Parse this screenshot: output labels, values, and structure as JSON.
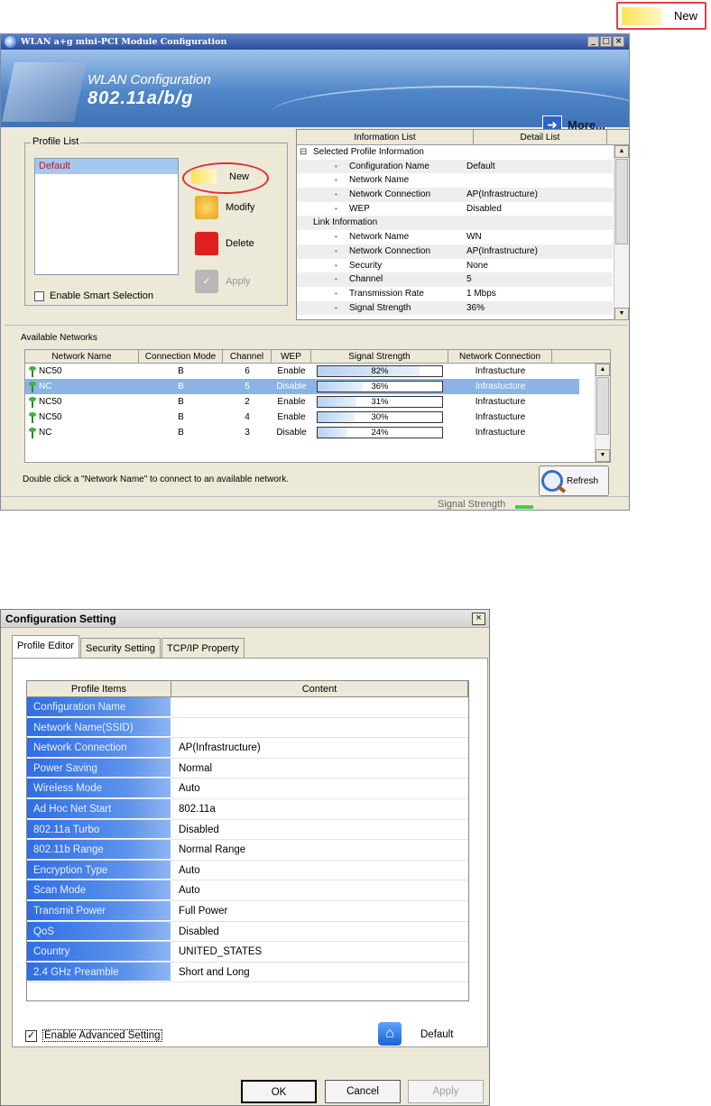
{
  "callout": {
    "label": "New"
  },
  "wlan_window": {
    "title": "WLAN a+g mini-PCI Module Configuration",
    "banner_line1": "WLAN Configuration",
    "banner_line2": "802.11a/b/g",
    "more_label": "More...",
    "profile_list": {
      "legend": "Profile List",
      "items": [
        "Default"
      ],
      "buttons": {
        "new": "New",
        "modify": "Modify",
        "delete": "Delete",
        "apply": "Apply"
      },
      "smart_selection_label": "Enable Smart Selection",
      "smart_selection_checked": false
    },
    "info_panel": {
      "headers": [
        "Information List",
        "Detail List"
      ],
      "rows": [
        {
          "type": "section",
          "label": "Selected Profile Information"
        },
        {
          "type": "item",
          "label": "Configuration Name",
          "value": "Default"
        },
        {
          "type": "item",
          "label": "Network Name",
          "value": ""
        },
        {
          "type": "item",
          "label": "Network Connection",
          "value": "AP(Infrastructure)"
        },
        {
          "type": "item",
          "label": "WEP",
          "value": "Disabled"
        },
        {
          "type": "section",
          "label": "Link Information"
        },
        {
          "type": "item",
          "label": "Network Name",
          "value": "WN"
        },
        {
          "type": "item",
          "label": "Network Connection",
          "value": "AP(Infrastructure)"
        },
        {
          "type": "item",
          "label": "Security",
          "value": "None"
        },
        {
          "type": "item",
          "label": "Channel",
          "value": "5"
        },
        {
          "type": "item",
          "label": "Transmission Rate",
          "value": "1 Mbps"
        },
        {
          "type": "item",
          "label": "Signal Strength",
          "value": "36%"
        }
      ]
    },
    "networks": {
      "title": "Available Networks",
      "headers": [
        "Network Name",
        "Connection Mode",
        "Channel",
        "WEP",
        "Signal Strength",
        "Network Connection"
      ],
      "rows": [
        {
          "name": "NC50",
          "mode": "B",
          "channel": "6",
          "wep": "Enable",
          "signal": "82%",
          "signal_fraction": 0.82,
          "connection": "Infrastucture",
          "selected": false
        },
        {
          "name": "NC",
          "mode": "B",
          "channel": "5",
          "wep": "Disable",
          "signal": "36%",
          "signal_fraction": 0.36,
          "connection": "Infrastucture",
          "selected": true
        },
        {
          "name": "NC50",
          "mode": "B",
          "channel": "2",
          "wep": "Enable",
          "signal": "31%",
          "signal_fraction": 0.31,
          "connection": "Infrastucture",
          "selected": false
        },
        {
          "name": "NC50",
          "mode": "B",
          "channel": "4",
          "wep": "Enable",
          "signal": "30%",
          "signal_fraction": 0.3,
          "connection": "Infrastucture",
          "selected": false
        },
        {
          "name": "NC",
          "mode": "B",
          "channel": "3",
          "wep": "Disable",
          "signal": "24%",
          "signal_fraction": 0.24,
          "connection": "Infrastucture",
          "selected": false
        }
      ],
      "hint": "Double click a \"Network Name\" to connect to an available network.",
      "refresh_label": "Refresh"
    },
    "status": {
      "signal_label": "Signal Strength"
    }
  },
  "config_window": {
    "title": "Configuration Setting",
    "close_glyph": "×",
    "tabs": [
      "Profile Editor",
      "Security Setting",
      "TCP/IP Property"
    ],
    "active_tab": 0,
    "table_headers": [
      "Profile Items",
      "Content"
    ],
    "rows": [
      {
        "item": "Configuration Name",
        "content": ""
      },
      {
        "item": "Network Name(SSID)",
        "content": ""
      },
      {
        "item": "Network Connection",
        "content": "AP(Infrastructure)"
      },
      {
        "item": "Power Saving",
        "content": "Normal"
      },
      {
        "item": "Wireless Mode",
        "content": "Auto"
      },
      {
        "item": "Ad Hoc Net Start",
        "content": "802.11a"
      },
      {
        "item": "802.11a Turbo",
        "content": "Disabled"
      },
      {
        "item": "802.11b Range",
        "content": "Normal Range"
      },
      {
        "item": "Encryption Type",
        "content": "Auto"
      },
      {
        "item": "Scan Mode",
        "content": "Auto"
      },
      {
        "item": "Transmit Power",
        "content": "Full Power"
      },
      {
        "item": "QoS",
        "content": "Disabled"
      },
      {
        "item": "Country",
        "content": "UNITED_STATES"
      },
      {
        "item": "2.4 GHz Preamble",
        "content": "Short and Long"
      }
    ],
    "advanced_label": "Enable Advanced Setting",
    "advanced_checked": true,
    "default_label": "Default",
    "buttons": {
      "ok": "OK",
      "cancel": "Cancel",
      "apply": "Apply"
    }
  }
}
